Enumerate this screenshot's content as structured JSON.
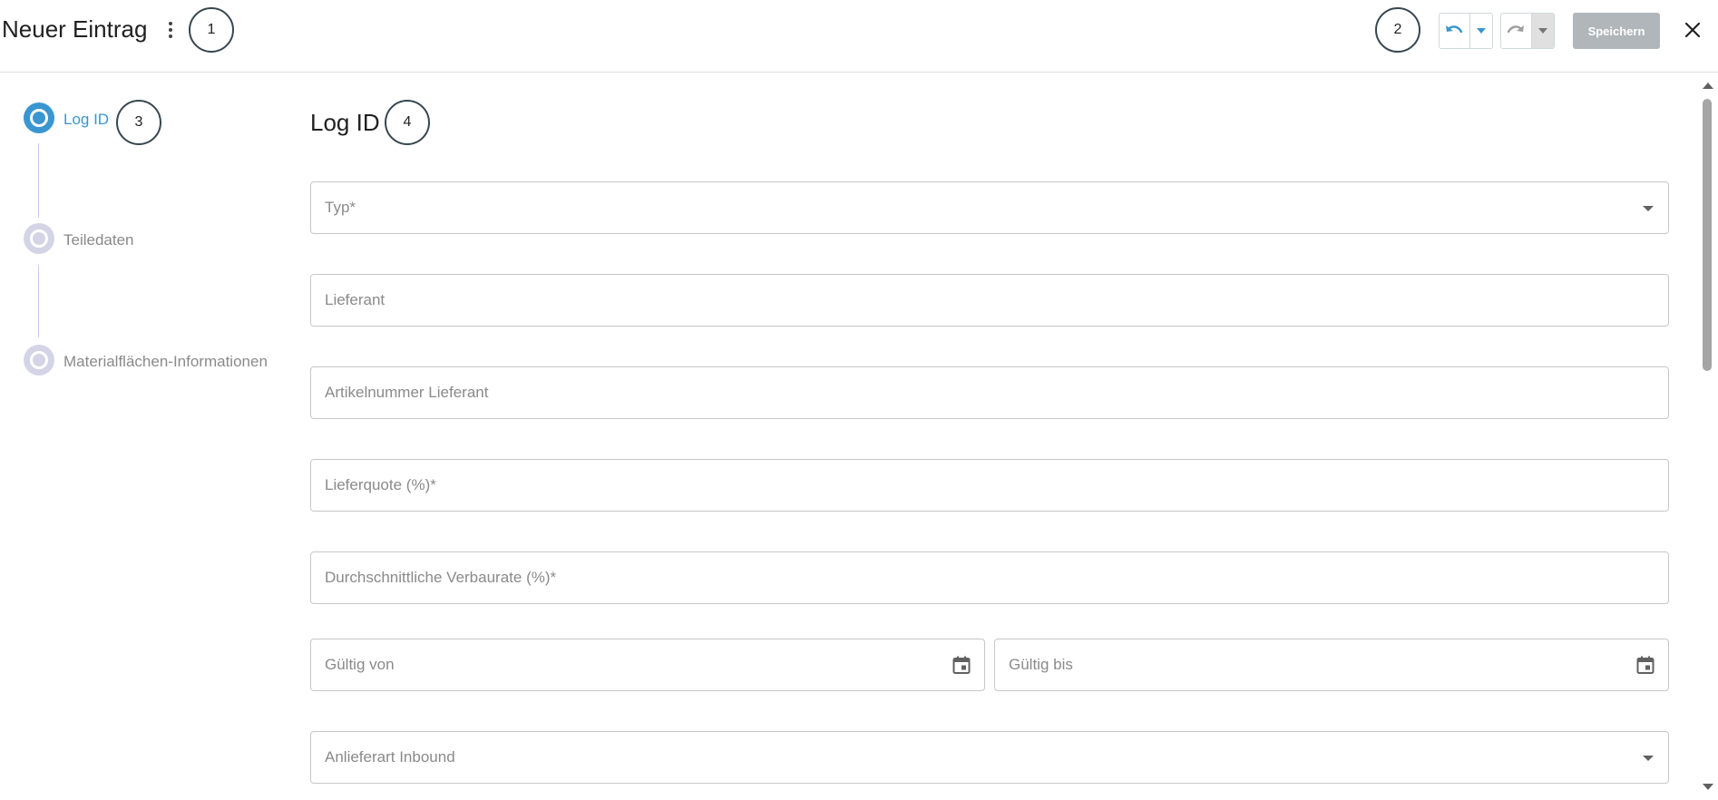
{
  "header": {
    "title": "Neuer Eintrag",
    "more_icon": "more-vert-icon",
    "save_label": "Speichern",
    "close_icon": "close-icon",
    "undo_icon": "undo-icon",
    "redo_icon": "redo-icon"
  },
  "markers": [
    "1",
    "2",
    "3",
    "4"
  ],
  "stepper": {
    "steps": [
      {
        "label": "Log ID",
        "state": "active"
      },
      {
        "label": "Teiledaten",
        "state": "inactive"
      },
      {
        "label": "Materialflächen-Informationen",
        "state": "inactive"
      }
    ]
  },
  "form": {
    "section_title": "Log ID",
    "fields": {
      "typ": "Typ*",
      "lieferant": "Lieferant",
      "artikelnummer": "Artikelnummer Lieferant",
      "lieferquote": "Lieferquote (%)*",
      "verbaurate": "Durchschnittliche Verbaurate (%)*",
      "gueltig_von": "Gültig von",
      "gueltig_bis": "Gültig bis",
      "anlieferart": "Anlieferart Inbound"
    }
  },
  "colors": {
    "accent": "#3a96d0",
    "inactive_step": "#d4d4e6",
    "save_disabled": "#b0b6ba",
    "field_border": "#c7c7c7"
  }
}
